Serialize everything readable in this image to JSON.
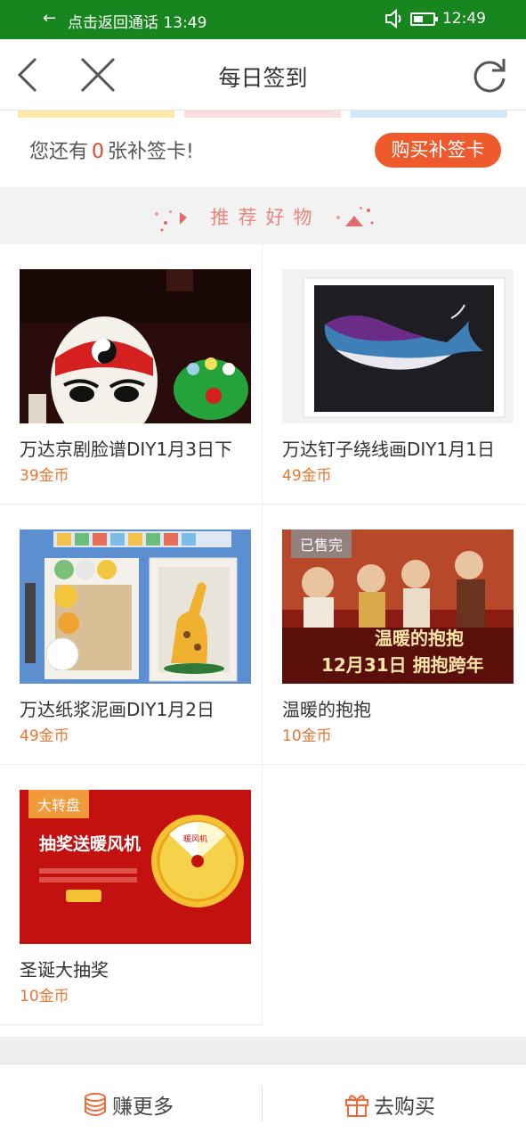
{
  "status_bar": {
    "call_text": "点击返回通话 13:49",
    "time": "12:49"
  },
  "nav": {
    "title": "每日签到"
  },
  "card_row": {
    "prefix": "您还有",
    "count": "0",
    "suffix": "张补签卡!",
    "buy_button": "购买补签卡"
  },
  "section": {
    "title_chars": [
      "推",
      "荐",
      "好",
      "物"
    ]
  },
  "products": [
    {
      "name": "万达京剧脸谱DIY1月3日下",
      "price": "39金币",
      "tag": ""
    },
    {
      "name": "万达钉子绕线画DIY1月1日",
      "price": "49金币",
      "tag": ""
    },
    {
      "name": "万达纸浆泥画DIY1月2日",
      "price": "49金币",
      "tag": ""
    },
    {
      "name": "温暖的抱抱",
      "price": "10金币",
      "tag": "已售完",
      "poster_title": "温暖的抱抱",
      "poster_subtitle": "12月31日 拥抱跨年"
    },
    {
      "name": "圣诞大抽奖",
      "price": "10金币",
      "tag": "大转盘",
      "banner_title": "抽奖送暖风机",
      "wheel_label": "暖风机"
    }
  ],
  "tabs": {
    "earn": "赚更多",
    "buy": "去购买"
  },
  "colors": {
    "status_green": "#17861f",
    "accent_orange": "#ee5a2c",
    "price_orange": "#e8762f"
  }
}
